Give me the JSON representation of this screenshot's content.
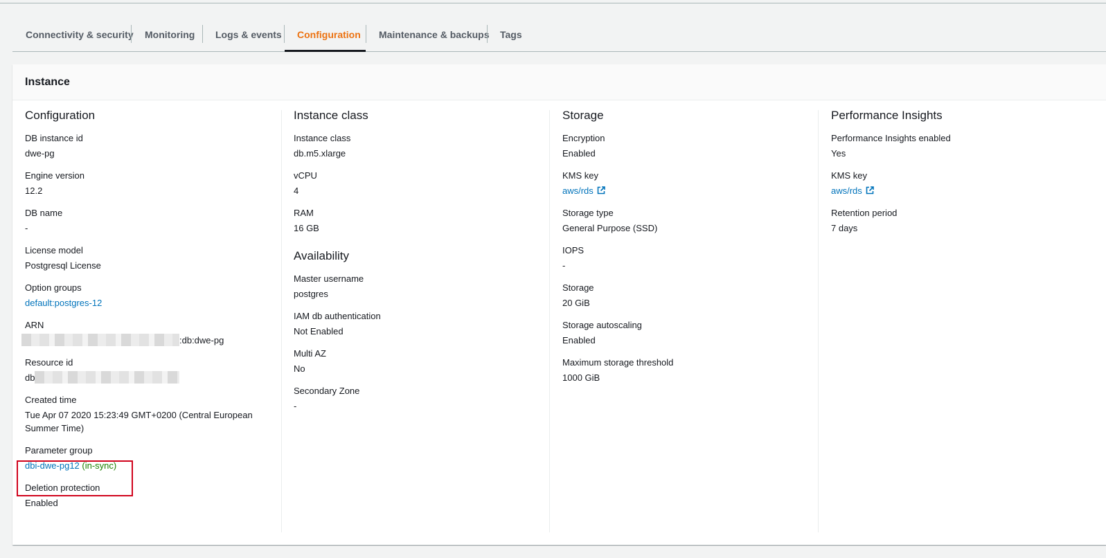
{
  "tabs": [
    {
      "label": "Connectivity & security"
    },
    {
      "label": "Monitoring"
    },
    {
      "label": "Logs & events"
    },
    {
      "label": "Configuration",
      "active": true
    },
    {
      "label": "Maintenance & backups"
    },
    {
      "label": "Tags"
    }
  ],
  "panel": {
    "title": "Instance"
  },
  "configuration": {
    "title": "Configuration",
    "db_instance_id": {
      "label": "DB instance id",
      "value": "dwe-pg"
    },
    "engine_version": {
      "label": "Engine version",
      "value": "12.2"
    },
    "db_name": {
      "label": "DB name",
      "value": "-"
    },
    "license_model": {
      "label": "License model",
      "value": "Postgresql License"
    },
    "option_groups": {
      "label": "Option groups",
      "value": "default:postgres-12"
    },
    "arn": {
      "label": "ARN",
      "value_suffix": ":db:dwe-pg"
    },
    "resource_id": {
      "label": "Resource id",
      "value_prefix": "db"
    },
    "created_time": {
      "label": "Created time",
      "value": "Tue Apr 07 2020 15:23:49 GMT+0200 (Central European Summer Time)"
    },
    "parameter_group": {
      "label": "Parameter group",
      "value": "dbi-dwe-pg12",
      "status": "(in-sync)"
    },
    "deletion_protection": {
      "label": "Deletion protection",
      "value": "Enabled"
    }
  },
  "instance_class": {
    "title": "Instance class",
    "instance_class": {
      "label": "Instance class",
      "value": "db.m5.xlarge"
    },
    "vcpu": {
      "label": "vCPU",
      "value": "4"
    },
    "ram": {
      "label": "RAM",
      "value": "16 GB"
    }
  },
  "availability": {
    "title": "Availability",
    "master_username": {
      "label": "Master username",
      "value": "postgres"
    },
    "iam_auth": {
      "label": "IAM db authentication",
      "value": "Not Enabled"
    },
    "multi_az": {
      "label": "Multi AZ",
      "value": "No"
    },
    "secondary_zone": {
      "label": "Secondary Zone",
      "value": "-"
    }
  },
  "storage": {
    "title": "Storage",
    "encryption": {
      "label": "Encryption",
      "value": "Enabled"
    },
    "kms_key": {
      "label": "KMS key",
      "value": "aws/rds"
    },
    "storage_type": {
      "label": "Storage type",
      "value": "General Purpose (SSD)"
    },
    "iops": {
      "label": "IOPS",
      "value": "-"
    },
    "storage": {
      "label": "Storage",
      "value": "20 GiB"
    },
    "autoscaling": {
      "label": "Storage autoscaling",
      "value": "Enabled"
    },
    "max_threshold": {
      "label": "Maximum storage threshold",
      "value": "1000 GiB"
    }
  },
  "performance_insights": {
    "title": "Performance Insights",
    "enabled": {
      "label": "Performance Insights enabled",
      "value": "Yes"
    },
    "kms_key": {
      "label": "KMS key",
      "value": "aws/rds"
    },
    "retention": {
      "label": "Retention period",
      "value": "7 days"
    }
  },
  "colors": {
    "accent": "#ec7211",
    "link": "#0073bb",
    "in_sync": "#1d8102",
    "highlight_box": "#d0021b"
  },
  "icons": {
    "external_link": "external-link-icon"
  }
}
